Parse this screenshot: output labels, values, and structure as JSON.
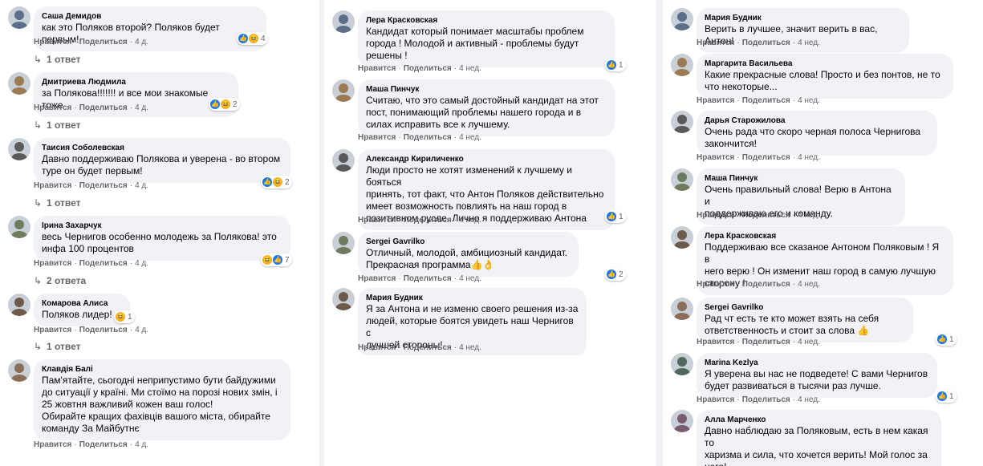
{
  "colors": {
    "link": "#65676b",
    "bubble": "#f0f2f5",
    "like": "#1877f2",
    "haha": "#f7b125"
  },
  "icons": {
    "like": "like-icon",
    "haha": "haha-icon",
    "reply": "reply-arrow-icon"
  },
  "labels": {
    "like": "Нравится",
    "reply": "Поделиться",
    "dot": "·"
  },
  "col1": [
    {
      "author": "Саша Демидов",
      "text": "как это Поляков второй? Поляков будет первым!",
      "time": "4 д.",
      "reactions": "4",
      "replies": "1 ответ"
    },
    {
      "author": "Дмитриева Людмила",
      "text": "за Полякова!!!!!!! и все мои знакомые тоже",
      "time": "4 д.",
      "reactions": "2",
      "replies": "1 ответ"
    },
    {
      "author": "Таисия Соболевская",
      "text": "Давно поддерживаю Полякова и уверена - во втором\nтуре он будет первым!",
      "time": "4 д.",
      "reactions": "2",
      "replies": "1 ответ"
    },
    {
      "author": "Ірина Захарчук",
      "text": "весь Чернигов особенно молодежь за Полякова! это\nинфа 100 процентов",
      "time": "4 д.",
      "reactions": "7",
      "replies": "2 ответа"
    },
    {
      "author": "Комарова Алиса",
      "text": "Поляков лидер!",
      "time": "4 д.",
      "reactions": "1",
      "replies": "1 ответ"
    },
    {
      "author": "Клавдія Балі",
      "text": "Пам'ятайте, сьогодні неприпустимо бути байдужими\nдо ситуації у країні. Ми стоїмо на порозі нових змін, і\n25 жовтня важливий кожен ваш голос!\nОбирайте кращих фахівців вашого міста, обирайте\nкоманду За Майбутнє",
      "time": "4 д.",
      "reactions": "",
      "replies": ""
    }
  ],
  "col2": [
    {
      "author": "Лера Красковская",
      "text": "Кандидат который понимает масштабы проблем\nгорода ! Молодой и активный - проблемы будут\nрешены !",
      "time": "4 нед.",
      "reactions": "1"
    },
    {
      "author": "Маша Пинчук",
      "text": "Считаю, что это самый достойный кандидат на этот\nпост, понимающий проблемы нашего города и в\nсилах исправить все к лучшему.",
      "time": "4 нед.",
      "reactions": ""
    },
    {
      "author": "Александр Кириличенко",
      "text": "Люди просто не хотят изменений к лучшему и бояться\nпринять, тот факт, что Антон Поляков действительно\nимеет возможность повлиять на наш город в\nпозитивном русле. Лично я поддерживаю Антона",
      "time": "4 нед.",
      "reactions": "1"
    },
    {
      "author": "Sergei Gavrilko",
      "text": "Отличный, молодой, амбициозный кандидат.\nПрекрасная программа👍👌",
      "time": "4 нед.",
      "reactions": "2"
    },
    {
      "author": "Мария Будник",
      "text": "Я за Антона и не изменю своего решения из-за\nлюдей, которые боятся увидеть наш Чернигов с\nлучшей стороны!",
      "time": "4 нед.",
      "reactions": ""
    }
  ],
  "col3": [
    {
      "author": "Мария Будник",
      "text": "Верить в лучшее, значит верить в вас, Антон!",
      "time": "4 нед.",
      "reactions": ""
    },
    {
      "author": "Маргарита Васильева",
      "text": "Какие прекрасные слова! Просто и без понтов, не то\nчто некоторые...",
      "time": "4 нед.",
      "reactions": ""
    },
    {
      "author": "Дарья Старожилова",
      "text": "Очень рада что скоро черная полоса Чернигова\nзакончится!",
      "time": "4 нед.",
      "reactions": ""
    },
    {
      "author": "Маша Пинчук",
      "text": "Очень правильный слова! Верю в Антона и\nподдерживаю его и команду.",
      "time": "4 нед.",
      "reactions": ""
    },
    {
      "author": "Лера Красковская",
      "text": "Поддерживаю все сказаное Антоном Поляковым ! Я в\nнего верю ! Он изменит наш город в самую лучшую\nсторону !",
      "time": "4 нед.",
      "reactions": ""
    },
    {
      "author": "Sergei Gavrilko",
      "text": "Рад чт есть те кто может взять на себя\nответственность и стоит за слова 👍",
      "time": "4 нед.",
      "reactions": "1"
    },
    {
      "author": "Marina Kezlya",
      "text": "Я уверена вы нас не подведете! С вами Чернигов\nбудет развиваться в тысячи раз лучше.",
      "time": "4 нед.",
      "reactions": "1"
    },
    {
      "author": "Алла Марченко",
      "text": "Давно наблюдаю за Поляковым, есть в нем какая то\nхаризма и сила, что хочется верить! Мой голос за\nнего!",
      "time": "",
      "reactions": ""
    }
  ]
}
